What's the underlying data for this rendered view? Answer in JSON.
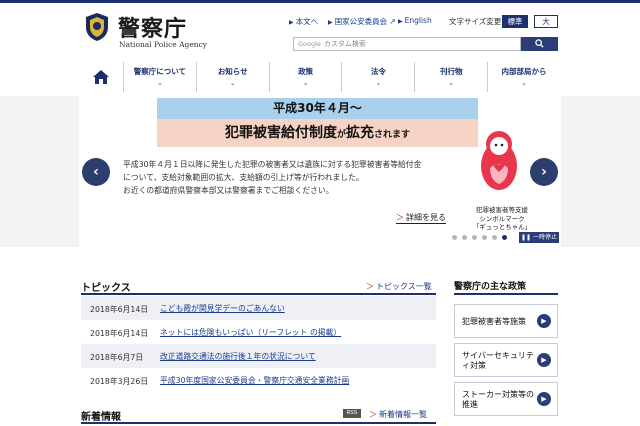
{
  "header": {
    "logo_jp": "警察庁",
    "logo_en": "National Police Agency",
    "utility": {
      "to_content": "本文へ",
      "commission": "国家公安委員会",
      "english": "English",
      "text_size_label": "文字サイズ変更",
      "standard": "標準",
      "large": "大"
    },
    "search": {
      "google_label": "Google",
      "placeholder": "カスタム検索"
    }
  },
  "nav": {
    "items": [
      {
        "label": "警察庁について"
      },
      {
        "label": "お知らせ"
      },
      {
        "label": "政策"
      },
      {
        "label": "法令"
      },
      {
        "label": "刊行物"
      },
      {
        "label": "内部部局から"
      }
    ]
  },
  "hero": {
    "banner_top": "平成30年４月〜",
    "banner_main_1": "犯罪被害給付制度",
    "banner_main_2": "が",
    "banner_main_3": "拡充",
    "banner_main_4": "されます",
    "text_1": "平成30年４月１日以降に発生した犯罪の被害者又は遺族に対する犯罪被害者等給付金",
    "text_2": "について、支給対象範囲の拡大、支給額の引上げ等が行われました。",
    "text_3": "お近くの都道府県警察本部又は警察署までご相談ください。",
    "more_link": "詳細を見る",
    "mascot_caption_1": "犯罪被害者等支援",
    "mascot_caption_2": "シンボルマーク",
    "mascot_caption_3": "「ギュっとちゃん」",
    "pause": "一時停止"
  },
  "topics": {
    "title": "トピックス",
    "list_link": "トピックス一覧",
    "rows": [
      {
        "date": "2018年6月14日",
        "title": "こども霞が関見学デーのごあんない"
      },
      {
        "date": "2018年6月14日",
        "title": "ネットには危険もいっぱい（リーフレット の掲載）"
      },
      {
        "date": "2018年6月7日",
        "title": "改正道路交通法の施行後１年の状況について"
      },
      {
        "date": "2018年3月26日",
        "title": "平成30年度国家公安委員会・警察庁交通安全業務計画"
      }
    ]
  },
  "news": {
    "title": "新着情報",
    "rss": "RSS",
    "list_link": "新着情報一覧"
  },
  "policies": {
    "title": "警察庁の主な政策",
    "items": [
      {
        "label": "犯罪被害者等施策"
      },
      {
        "label": "サイバーセキュリティ対策"
      },
      {
        "label": "ストーカー対策等の推進"
      }
    ]
  },
  "colors": {
    "navy": "#1d2f6f",
    "banner_blue": "#a9d0ec",
    "banner_pink": "#f6d3c4",
    "accent_red": "#c2273d"
  }
}
